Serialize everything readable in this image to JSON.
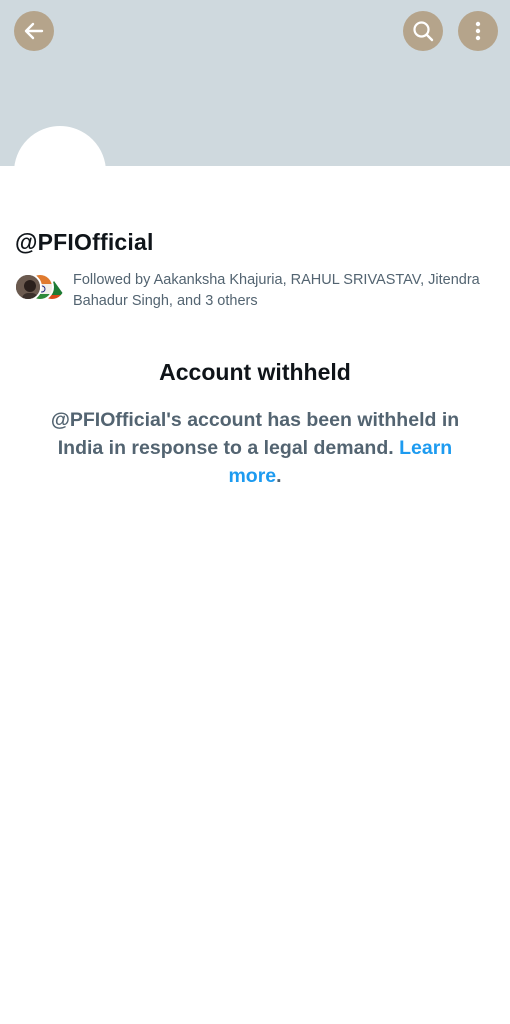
{
  "profile": {
    "handle": "@PFIOfficial",
    "followed_by": "Followed by Aakanksha Khajuria, RAHUL SRIVASTAV, Jitendra Bahadur Singh, and 3 others"
  },
  "header": {
    "back_icon": "arrow-left-icon",
    "search_icon": "search-icon",
    "more_icon": "more-vertical-icon",
    "button_color": "#b5a48b",
    "banner_color": "#cfd9de"
  },
  "withheld": {
    "title": "Account withheld",
    "message_prefix": "@PFIOfficial's account has been withheld in India in response to a legal demand.",
    "learn_more": "Learn more",
    "period": "."
  },
  "colors": {
    "link": "#1d9bf0",
    "secondary_text": "#536471",
    "primary_text": "#0f1419"
  }
}
